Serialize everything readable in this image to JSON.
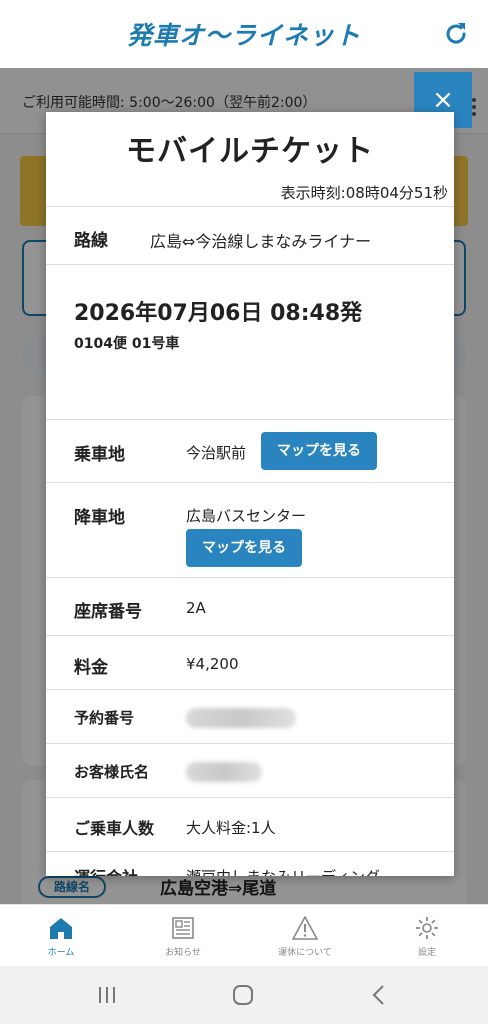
{
  "app": {
    "logo_text": "発車オ〜ライネット"
  },
  "background": {
    "hours_text": "ご利用可能時間: 5:00〜26:00（翌午前2:00）",
    "route_tag": "路線名",
    "route_name": "広島空港⇒尾道"
  },
  "modal": {
    "title": "モバイルチケット",
    "display_time": "表示時刻:08時04分51秒",
    "route": {
      "label": "路線",
      "value": "広島⇔今治線しまなみライナー"
    },
    "departure": {
      "datetime": "2026年07月06日 08:48発",
      "flight": "0104便 01号車"
    },
    "boarding": {
      "label": "乗車地",
      "value": "今治駅前",
      "map_button": "マップを見る"
    },
    "alighting": {
      "label": "降車地",
      "value": "広島バスセンター",
      "map_button": "マップを見る"
    },
    "seat": {
      "label": "座席番号",
      "value": "2A"
    },
    "fare": {
      "label": "料金",
      "value": "¥4,200"
    },
    "reservation": {
      "label": "予約番号"
    },
    "customer": {
      "label": "お客様氏名"
    },
    "passengers": {
      "label": "ご乗車人数",
      "value": "大人料金:1人"
    },
    "operator": {
      "label": "運行会社",
      "value": "瀬戸内しまなみリーディング"
    },
    "close_label": "×"
  },
  "bottom_nav": {
    "items": [
      {
        "label": "ホーム",
        "icon": "home-icon"
      },
      {
        "label": "お知らせ",
        "icon": "news-icon"
      },
      {
        "label": "運休について",
        "icon": "warning-icon"
      },
      {
        "label": "設定",
        "icon": "gear-icon"
      }
    ]
  },
  "colors": {
    "brand_blue": "#1d7bb0",
    "button_blue": "#2a84bf"
  }
}
